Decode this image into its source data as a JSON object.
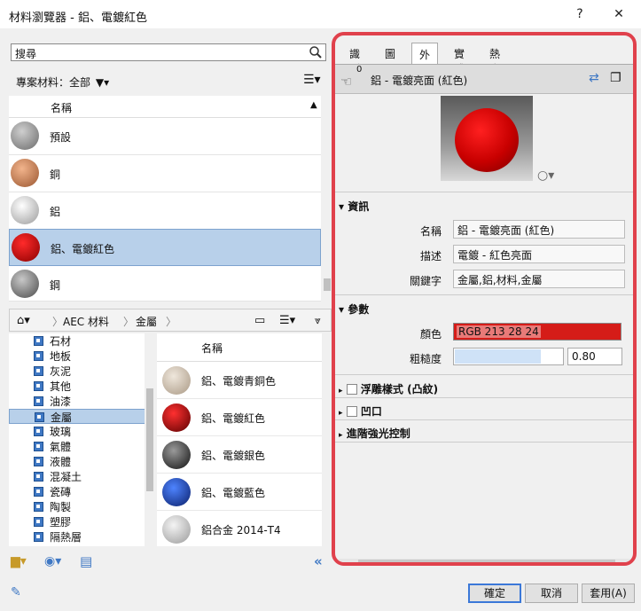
{
  "window": {
    "title": "材料瀏覽器 - 鋁、電鍍紅色",
    "help": "?",
    "close": "✕"
  },
  "search": {
    "value": "搜尋"
  },
  "filter": {
    "label": "專案材料：全部"
  },
  "project_list": {
    "header": "名稱",
    "items": [
      {
        "label": "預設",
        "color": "#8a8a8a"
      },
      {
        "label": "銅",
        "color": "#c07a4e"
      },
      {
        "label": "鋁",
        "color": "#d4d4d4"
      },
      {
        "label": "鋁、電鍍紅色",
        "color": "#d00000"
      },
      {
        "label": "鋼",
        "color": "#7e7e7e"
      }
    ]
  },
  "breadcrumb": {
    "root": "AEC 材料",
    "current": "金屬"
  },
  "library_tree": {
    "items": [
      "石材",
      "地板",
      "灰泥",
      "其他",
      "油漆",
      "金屬",
      "玻璃",
      "氣體",
      "液體",
      "混凝土",
      "瓷磚",
      "陶製",
      "塑膠",
      "隔熱層"
    ],
    "selected": "金屬"
  },
  "library_grid": {
    "header": "名稱",
    "items": [
      {
        "label": "鋁、電鍍青銅色",
        "color": "#cfc3b3"
      },
      {
        "label": "鋁、電鍍紅色",
        "color": "#cc0000"
      },
      {
        "label": "鋁、電鍍銀色",
        "color": "#555555"
      },
      {
        "label": "鋁、電鍍藍色",
        "color": "#1f4fbf"
      },
      {
        "label": "鋁合金 2014-T4",
        "color": "#c8c8c8"
      }
    ]
  },
  "tabs": [
    "識別",
    "圖形",
    "外觀",
    "實體",
    "熱度"
  ],
  "active_tab": "外觀",
  "appearance": {
    "usage_count": "0",
    "asset_name": "鋁 - 電鍍亮面 (紅色)",
    "info_section": "資訊",
    "name_label": "名稱",
    "name_value": "鋁 - 電鍍亮面 (紅色)",
    "desc_label": "描述",
    "desc_value": "電鍍 - 紅色亮面",
    "keywords_label": "關鍵字",
    "keywords_value": "金屬,鋁,材料,金屬",
    "params_section": "參數",
    "color_label": "顏色",
    "color_value": "RGB 213 28 24",
    "color_hex": "#d51c18",
    "roughness_label": "粗糙度",
    "roughness_value": "0.80",
    "roughness_fraction": 0.8,
    "relief": "浮雕樣式 (凸紋)",
    "cutout": "凹口",
    "advanced": "進階強光控制"
  },
  "buttons": {
    "ok": "確定",
    "cancel": "取消",
    "apply": "套用(A)"
  }
}
